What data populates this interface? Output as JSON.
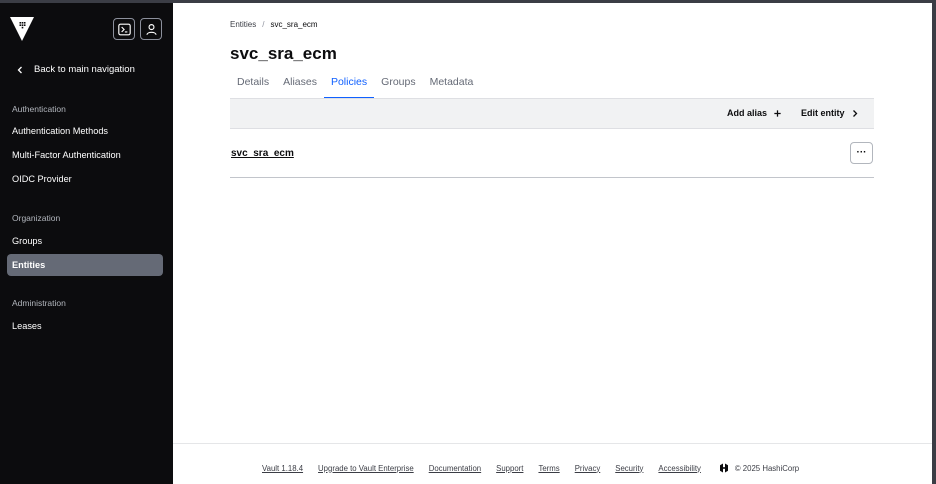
{
  "sidebar": {
    "back_label": "Back to main navigation",
    "sections": [
      {
        "title": "Authentication",
        "items": [
          "Authentication Methods",
          "Multi-Factor Authentication",
          "OIDC Provider"
        ]
      },
      {
        "title": "Organization",
        "items": [
          "Groups",
          "Entities"
        ]
      },
      {
        "title": "Administration",
        "items": [
          "Leases"
        ]
      }
    ],
    "active_item": "Entities"
  },
  "breadcrumb": {
    "parent": "Entities",
    "separator": "/",
    "current": "svc_sra_ecm"
  },
  "page": {
    "title": "svc_sra_ecm"
  },
  "tabs": [
    "Details",
    "Aliases",
    "Policies",
    "Groups",
    "Metadata"
  ],
  "active_tab": "Policies",
  "toolbar": {
    "add_alias": "Add alias",
    "edit_entity": "Edit entity"
  },
  "policies": [
    {
      "name": "svc_sra_ecm",
      "menu": "···"
    }
  ],
  "footer": {
    "links": [
      "Vault 1.18.4",
      "Upgrade to Vault Enterprise",
      "Documentation",
      "Support",
      "Terms",
      "Privacy",
      "Security",
      "Accessibility"
    ],
    "copyright": "© 2025 HashiCorp"
  },
  "icons": {
    "logo": "vault-logo-icon",
    "console": "terminal-icon",
    "user": "user-icon",
    "back": "chevron-left-icon",
    "add": "plus-icon",
    "edit": "chevron-right-icon",
    "footer": "hashicorp-logo-icon"
  },
  "colors": {
    "accent": "#1060ff",
    "sidebar_bg": "#0c0c0e",
    "active_nav_bg": "#656a76"
  }
}
